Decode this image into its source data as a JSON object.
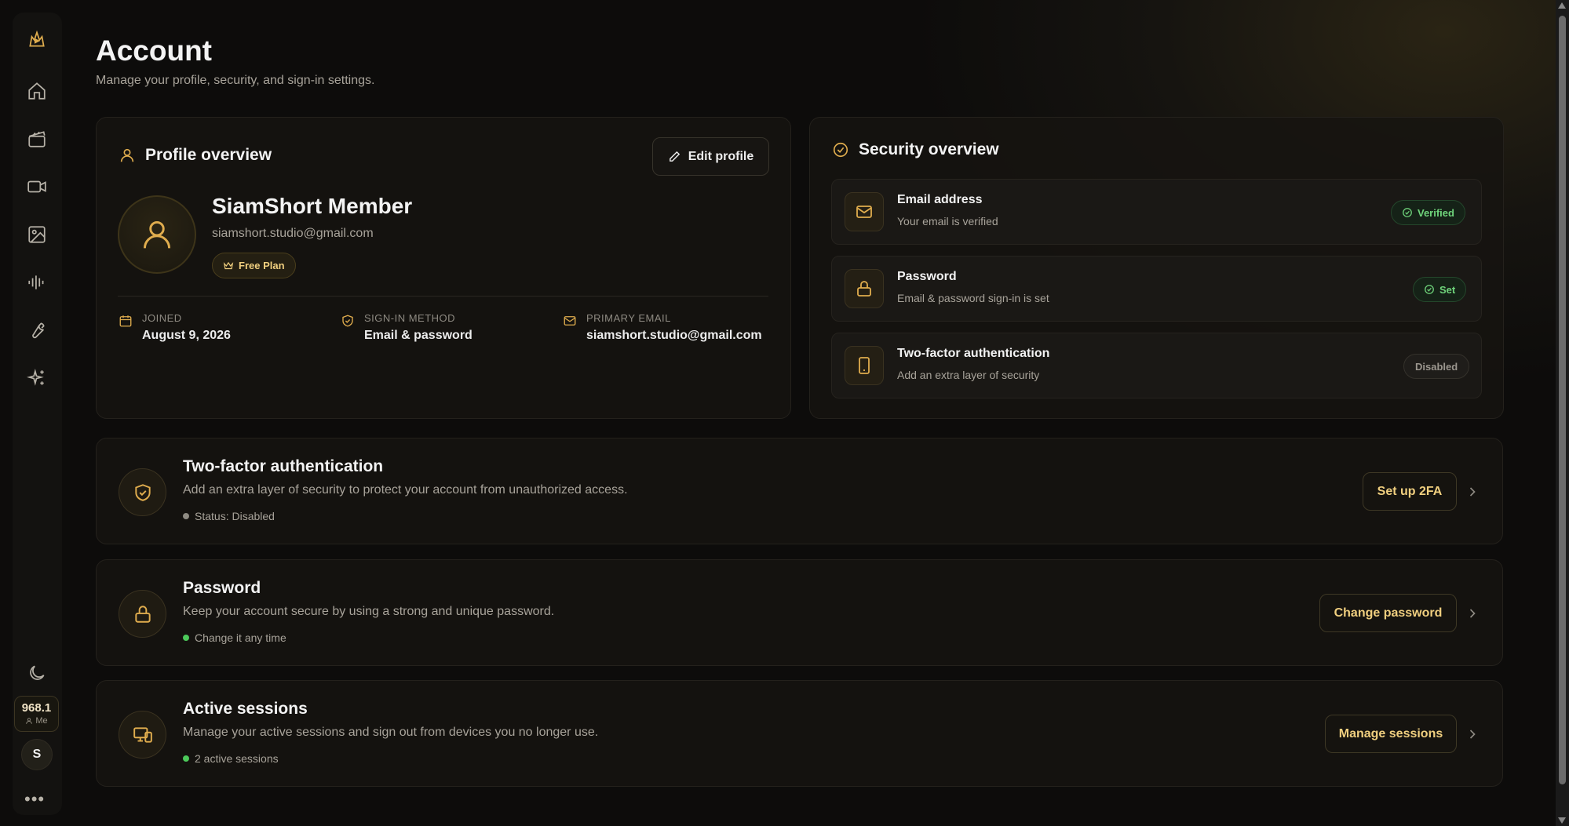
{
  "page": {
    "title": "Account",
    "subtitle": "Manage your profile, security, and sign-in settings."
  },
  "sidebar": {
    "items": [
      {
        "icon": "logo-icon"
      },
      {
        "icon": "home-icon"
      },
      {
        "icon": "clapperboard-icon"
      },
      {
        "icon": "video-camera-icon"
      },
      {
        "icon": "image-icon"
      },
      {
        "icon": "audio-waveform-icon"
      },
      {
        "icon": "wrench-icon"
      },
      {
        "icon": "sparkles-icon"
      }
    ],
    "theme_icon": "moon-icon",
    "credits": {
      "value": "968.1",
      "label": "Me"
    },
    "avatar_initial": "S",
    "more_label": "•••"
  },
  "profile": {
    "section_title": "Profile overview",
    "edit_label": "Edit profile",
    "name": "SiamShort Member",
    "email": "siamshort.studio@gmail.com",
    "plan": "Free Plan",
    "meta": [
      {
        "label": "JOINED",
        "value": "August 9, 2026"
      },
      {
        "label": "SIGN-IN METHOD",
        "value": "Email & password"
      },
      {
        "label": "PRIMARY EMAIL",
        "value": "siamshort.studio@gmail.com"
      }
    ]
  },
  "security": {
    "section_title": "Security overview",
    "rows": [
      {
        "title": "Email address",
        "subtitle": "Your email is verified",
        "status": "Verified"
      },
      {
        "title": "Password",
        "subtitle": "Email & password sign-in is set",
        "status": "Set"
      },
      {
        "title": "Two-factor authentication",
        "subtitle": "Add an extra layer of security",
        "status": "Disabled"
      }
    ]
  },
  "settings": [
    {
      "title": "Two-factor authentication",
      "subtitle": "Add an extra layer of security to protect your account from unauthorized access.",
      "status": "Status: Disabled",
      "action": "Set up 2FA"
    },
    {
      "title": "Password",
      "subtitle": "Keep your account secure by using a strong and unique password.",
      "status": "Change it any time",
      "action": "Change password"
    },
    {
      "title": "Active sessions",
      "subtitle": "Manage your active sessions and sign out from devices you no longer use.",
      "status": "2 active sessions",
      "action": "Manage sessions"
    }
  ],
  "colors": {
    "accent": "#e0ad4e",
    "success": "#6fd47b",
    "muted": "#8e8a82"
  }
}
